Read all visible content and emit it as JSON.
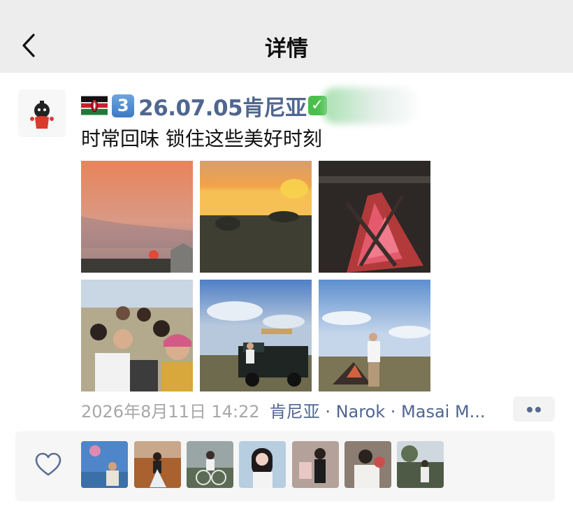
{
  "header": {
    "title": "详情",
    "back_icon": "chevron-left-icon"
  },
  "post": {
    "author": {
      "flag": "kenya-flag",
      "number_badge": "3",
      "name": "26.07.05肯尼亚",
      "check_badge": "✓"
    },
    "text": "时常回味 锁住这些美好时刻",
    "photos": [
      {
        "subject": "sunset-pink-sky"
      },
      {
        "subject": "sunset-savanna"
      },
      {
        "subject": "campfire"
      },
      {
        "subject": "group-selfie"
      },
      {
        "subject": "safari-jeep"
      },
      {
        "subject": "man-by-fire"
      }
    ],
    "timestamp": "2026年8月11日 14:22",
    "location": "肯尼亚 · Narok · Masai M...",
    "more_icon": "more-dots-icon"
  },
  "likes": {
    "heart_icon": "heart-icon",
    "avatars": [
      "liker-1",
      "liker-2",
      "liker-3",
      "liker-4",
      "liker-5",
      "liker-6",
      "liker-7"
    ]
  },
  "colors": {
    "header_bg": "#ededed",
    "name_link": "#4f668f",
    "meta_gray": "#a7a7a7",
    "likes_bg": "#f6f6f6"
  }
}
